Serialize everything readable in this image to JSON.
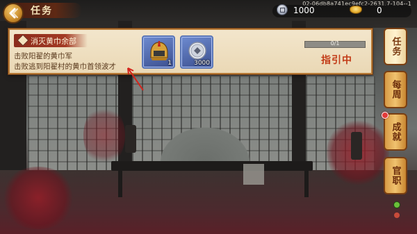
{
  "header": {
    "title": "任务",
    "version": "02-06db8a741ec9efc2-2631.7-104--1"
  },
  "currency": {
    "coin_value": "1000",
    "gold_value": "0"
  },
  "quest": {
    "name": "消灭黄巾余部",
    "objectives": [
      "击败阳翟的黄巾军",
      "击败逃到阳翟村的黄巾首领波才"
    ],
    "rewards": [
      {
        "icon": "helmet-icon",
        "count": "1"
      },
      {
        "icon": "silver-coin-icon",
        "count": "3000"
      }
    ],
    "progress_text": "0/1",
    "progress": 0,
    "status": "指引中"
  },
  "side_tabs": [
    {
      "label": "任务",
      "active": true
    },
    {
      "label": "每周",
      "active": false
    },
    {
      "label": "成就",
      "active": false
    },
    {
      "label": "官职",
      "active": false
    }
  ],
  "colors": {
    "status": "#c23b17",
    "panel": "#f3e6cc",
    "reward_frame": "#5a76b6"
  }
}
